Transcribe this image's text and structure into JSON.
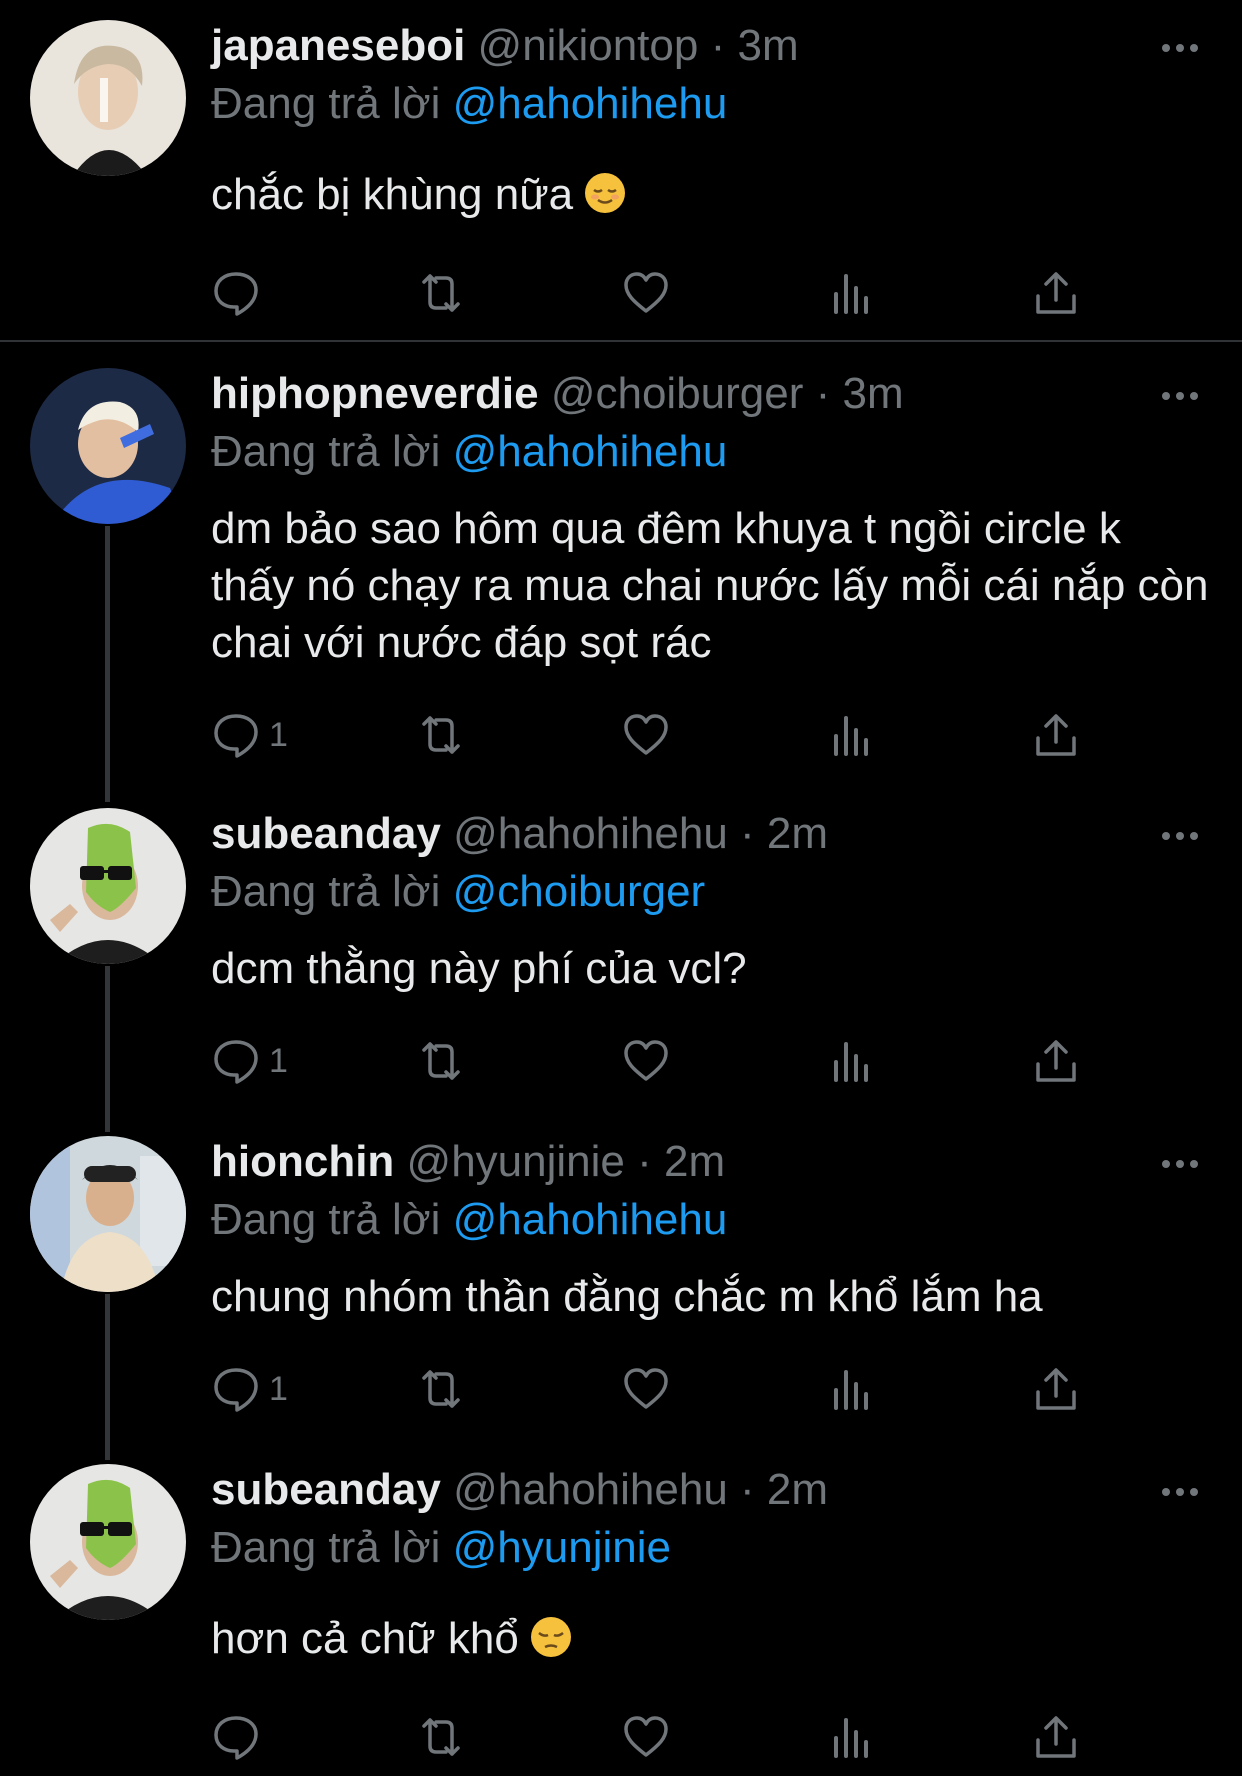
{
  "colors": {
    "background": "#000000",
    "text": "#e7e9ea",
    "muted": "#71767b",
    "mention": "#1d9bf0",
    "thread_line": "#333639"
  },
  "reply_prefix": "Đang trả lời",
  "tweets": [
    {
      "name": "japaneseboi",
      "handle": "@nikiontop",
      "dot": "·",
      "time": "3m",
      "reply_to": "@hahohihehu",
      "text": "chắc bị khùng nữa",
      "emoji": "relieved-face",
      "reply_count": ""
    },
    {
      "name": "hiphopneverdie",
      "handle": "@choiburger",
      "dot": "·",
      "time": "3m",
      "reply_to": "@hahohihehu",
      "text": "dm bảo sao hôm qua đêm khuya t ngồi circle k thấy nó chạy ra mua chai nước lấy mỗi cái nắp còn chai với nước đáp sọt rác",
      "emoji": "",
      "reply_count": "1"
    },
    {
      "name": "subeanday",
      "handle": "@hahohihehu",
      "dot": "·",
      "time": "2m",
      "reply_to": "@choiburger",
      "text": "dcm thằng này phí của vcl?",
      "emoji": "",
      "reply_count": "1"
    },
    {
      "name": "hionchin",
      "handle": "@hyunjinie",
      "dot": "·",
      "time": "2m",
      "reply_to": "@hahohihehu",
      "text": "chung nhóm thần đằng chắc m khổ lắm ha",
      "emoji": "",
      "reply_count": "1"
    },
    {
      "name": "subeanday",
      "handle": "@hahohihehu",
      "dot": "·",
      "time": "2m",
      "reply_to": "@hyunjinie",
      "text": "hơn cả chữ khổ",
      "emoji": "pensive-face",
      "reply_count": ""
    }
  ]
}
